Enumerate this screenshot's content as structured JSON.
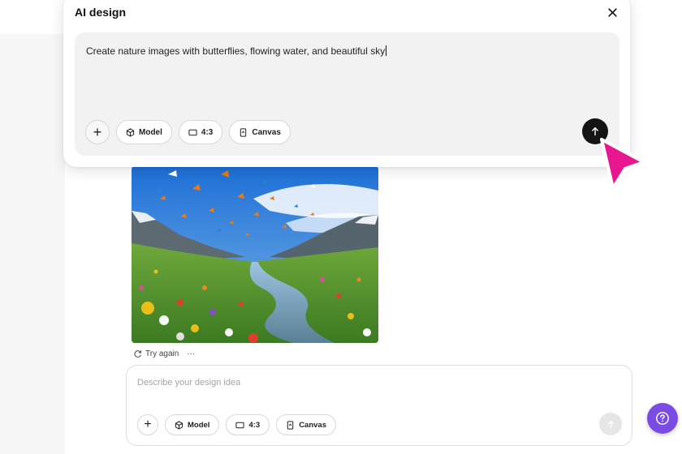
{
  "dialog": {
    "title": "AI design",
    "prompt_text": "Create nature images with butterflies, flowing water, and beautiful sky",
    "chips": {
      "model": "Model",
      "ratio": "4:3",
      "canvas": "Canvas"
    }
  },
  "image_actions": {
    "try_again": "Try again",
    "more": "···"
  },
  "composer": {
    "placeholder": "Describe your design idea",
    "chips": {
      "model": "Model",
      "ratio": "4:3",
      "canvas": "Canvas"
    }
  },
  "colors": {
    "cursor": "#e8168f",
    "help_button": "#7b4ce3",
    "send_active": "#141414",
    "send_disabled": "#e6e6e8"
  },
  "icons": {
    "close": "close-icon",
    "plus": "plus-icon",
    "model": "cube-icon",
    "ratio": "rectangle-icon",
    "canvas": "canvas-icon",
    "send": "arrow-up-icon",
    "retry": "refresh-icon",
    "help": "question-mark-icon"
  }
}
